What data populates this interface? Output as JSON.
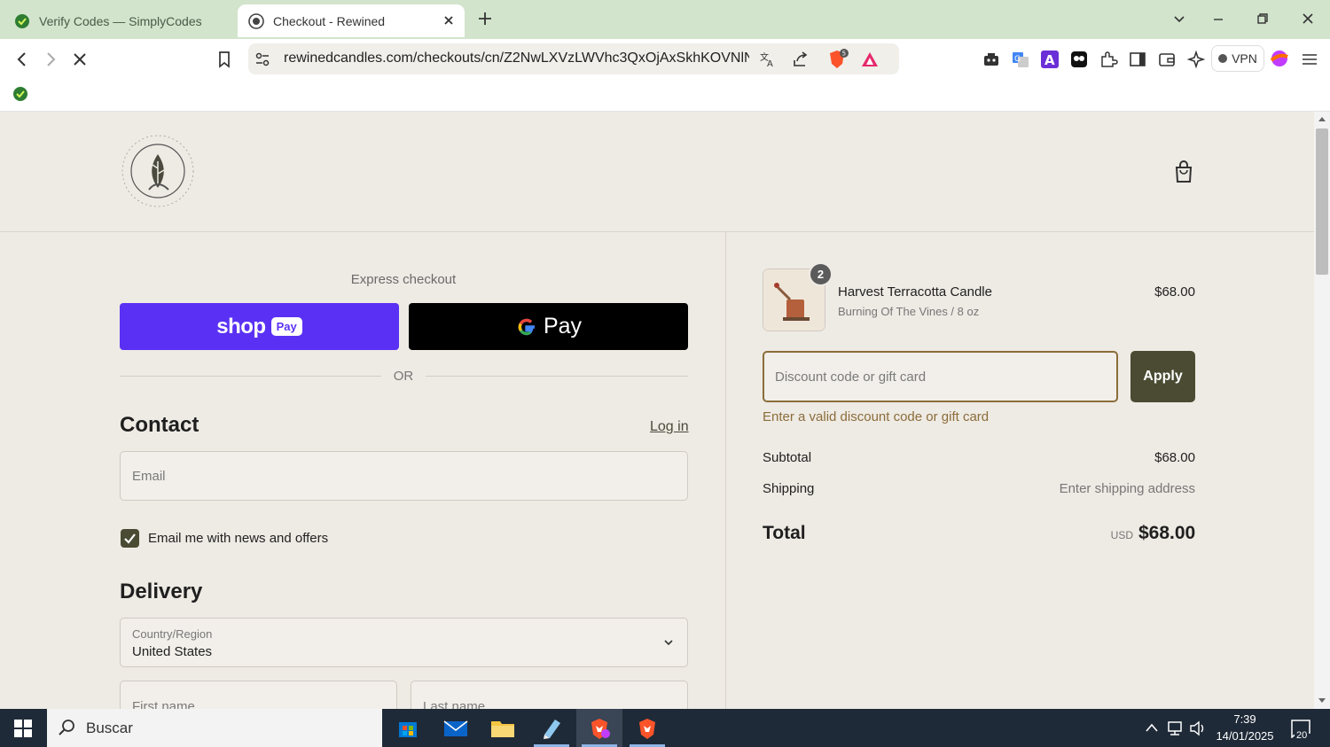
{
  "browser": {
    "tabs": [
      {
        "title": "Verify Codes — SimplyCodes",
        "active": false
      },
      {
        "title": "Checkout - Rewined",
        "active": true
      }
    ],
    "url": "rewinedcandles.com/checkouts/cn/Z2NwLXVzLWVhc3QxOjAxSkhKOVNlNzl...",
    "vpn_label": "VPN",
    "brave_shield_count": "5"
  },
  "checkout": {
    "express_label": "Express checkout",
    "shop_pay": {
      "shop": "shop",
      "pay": "Pay"
    },
    "gpay_label": "Pay",
    "or_label": "OR",
    "contact": {
      "title": "Contact",
      "login_label": "Log in",
      "email_placeholder": "Email",
      "newsletter_label": "Email me with news and offers",
      "newsletter_checked": true
    },
    "delivery": {
      "title": "Delivery",
      "country_label": "Country/Region",
      "country_value": "United States",
      "first_name_placeholder": "First name",
      "last_name_placeholder": "Last name"
    }
  },
  "summary": {
    "item": {
      "name": "Harvest Terracotta Candle",
      "variant": "Burning Of The Vines / 8 oz",
      "price": "$68.00",
      "quantity": "2"
    },
    "discount_placeholder": "Discount code or gift card",
    "apply_label": "Apply",
    "discount_error": "Enter a valid discount code or gift card",
    "subtotal_label": "Subtotal",
    "subtotal_value": "$68.00",
    "shipping_label": "Shipping",
    "shipping_value": "Enter shipping address",
    "total_label": "Total",
    "total_currency": "USD",
    "total_value": "$68.00"
  },
  "taskbar": {
    "search_text": "Buscar",
    "time": "7:39",
    "date": "14/01/2025",
    "notifications": "20"
  },
  "colors": {
    "page_bg": "#eeeae4",
    "shop_pay": "#5a31f4",
    "accent_olive": "#4a4b32",
    "error_brown": "#8b6d3a",
    "tabbar_green": "#d2e4cc"
  }
}
